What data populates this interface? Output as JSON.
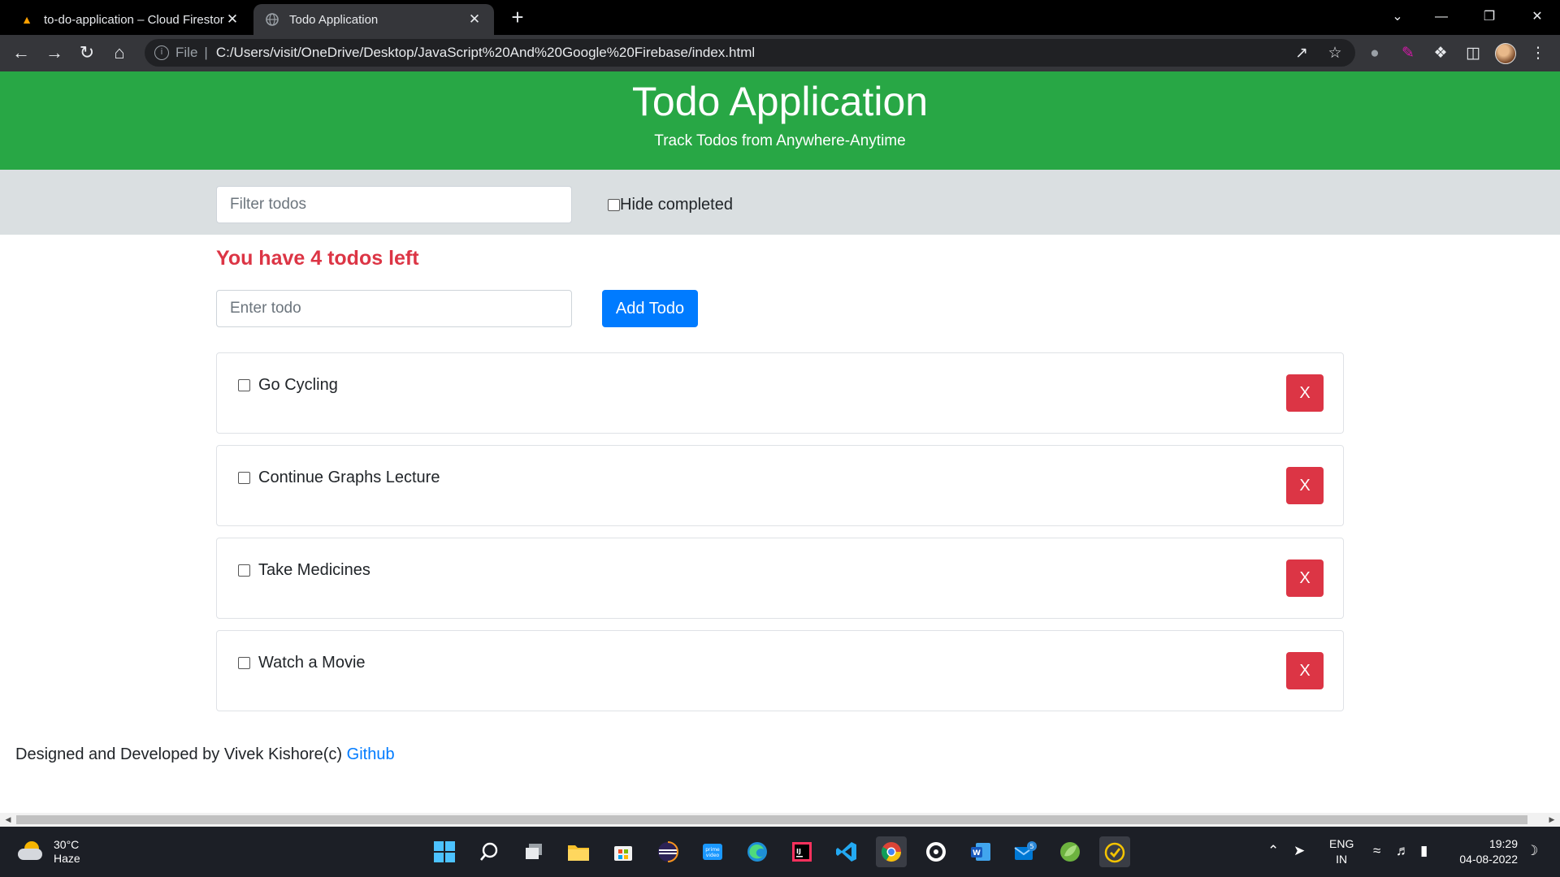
{
  "browser": {
    "tabs": [
      {
        "title": "to-do-application – Cloud Firestore",
        "favicon": "firebase-icon",
        "active": false
      },
      {
        "title": "Todo Application",
        "favicon": "globe-icon",
        "active": true
      }
    ],
    "address": {
      "scheme": "File",
      "separator": "|",
      "url": "C:/Users/visit/OneDrive/Desktop/JavaScript%20And%20Google%20Firebase/index.html"
    }
  },
  "header": {
    "title": "Todo Application",
    "subtitle": "Track Todos from Anywhere-Anytime"
  },
  "filter": {
    "placeholder": "Filter todos",
    "hide_completed_label": "Hide completed"
  },
  "summary": {
    "text": "You have 4 todos left"
  },
  "add": {
    "placeholder": "Enter todo",
    "button_label": "Add Todo"
  },
  "todos": [
    {
      "text": "Go Cycling",
      "delete_label": "X"
    },
    {
      "text": "Continue Graphs Lecture",
      "delete_label": "X"
    },
    {
      "text": "Take Medicines",
      "delete_label": "X"
    },
    {
      "text": "Watch a Movie",
      "delete_label": "X"
    }
  ],
  "footer": {
    "text": "Designed and Developed by Vivek Kishore(c) ",
    "link_label": "Github"
  },
  "taskbar": {
    "weather": {
      "temp": "30°C",
      "condition": "Haze"
    },
    "mail_badge": "5",
    "language": {
      "line1": "ENG",
      "line2": "IN"
    },
    "clock": {
      "time": "19:29",
      "date": "04-08-2022"
    }
  },
  "colors": {
    "header_green": "#28a745",
    "filter_bar": "#dadfe1",
    "danger": "#dc3545",
    "primary": "#007bff"
  }
}
